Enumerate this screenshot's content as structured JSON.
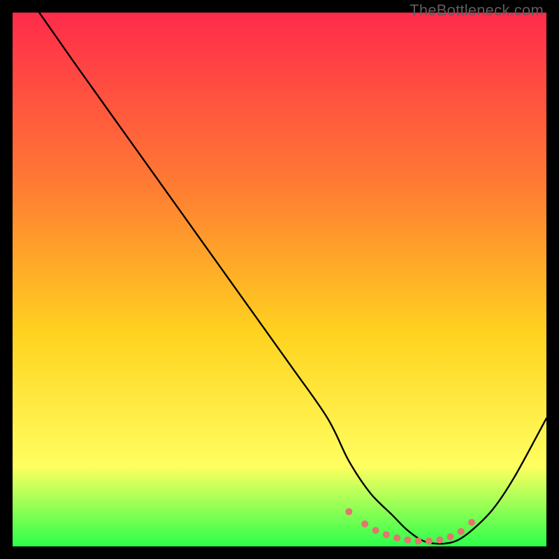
{
  "watermark": "TheBottleneck.com",
  "colors": {
    "gradient_top": "#ff2b4b",
    "gradient_mid1": "#ff7a33",
    "gradient_mid2": "#ffd21f",
    "gradient_mid3": "#ffff60",
    "gradient_bottom": "#2cff4b",
    "curve": "#000000",
    "marker": "#e4746f"
  },
  "chart_data": {
    "type": "line",
    "title": "",
    "xlabel": "",
    "ylabel": "",
    "xlim": [
      0,
      100
    ],
    "ylim": [
      0,
      100
    ],
    "series": [
      {
        "name": "bottleneck-curve",
        "x": [
          5,
          12,
          22,
          32,
          42,
          52,
          59,
          63,
          67,
          71,
          74,
          77,
          80,
          83,
          86,
          90,
          94,
          100
        ],
        "y": [
          100,
          90,
          76,
          62,
          48,
          34,
          24,
          16,
          10,
          6,
          3,
          1,
          0.5,
          1,
          3,
          7,
          13,
          24
        ]
      }
    ],
    "markers": {
      "name": "highlight-dots",
      "x": [
        63,
        66,
        68,
        70,
        72,
        74,
        76,
        78,
        80,
        82,
        84,
        86
      ],
      "y": [
        6.5,
        4.2,
        3.0,
        2.2,
        1.6,
        1.2,
        1.0,
        1.0,
        1.2,
        1.8,
        2.8,
        4.5
      ]
    }
  }
}
